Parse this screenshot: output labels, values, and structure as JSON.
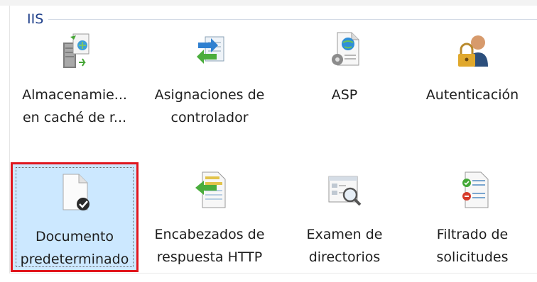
{
  "group": {
    "title": "IIS"
  },
  "features": [
    {
      "icon": "server-cache-icon",
      "line1": "Almacenamie...",
      "line2": "en caché de r..."
    },
    {
      "icon": "handler-mappings-icon",
      "line1": "Asignaciones de",
      "line2": "controlador"
    },
    {
      "icon": "asp-icon",
      "line1": "ASP",
      "line2": ""
    },
    {
      "icon": "authentication-icon",
      "line1": "Autenticación",
      "line2": ""
    },
    {
      "icon": "default-document-icon",
      "line1": "Documento",
      "line2": "predeterminado"
    },
    {
      "icon": "http-response-headers-icon",
      "line1": "Encabezados de",
      "line2": "respuesta HTTP"
    },
    {
      "icon": "directory-browsing-icon",
      "line1": "Examen de",
      "line2": "directorios"
    },
    {
      "icon": "request-filtering-icon",
      "line1": "Filtrado de",
      "line2": "solicitudes"
    }
  ],
  "selected_index": 4,
  "colors": {
    "selection_bg": "#cce8ff",
    "highlight_border": "#e0161e",
    "group_title": "#1e3f8a"
  }
}
